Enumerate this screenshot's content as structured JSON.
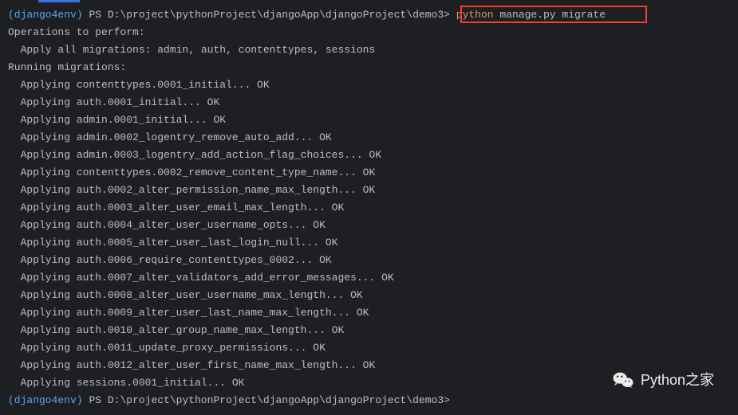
{
  "prompt": {
    "env": "(django4env)",
    "ps": "PS",
    "path": "D:\\project\\pythonProject\\djangoApp\\djangoProject\\demo3",
    "caret": ">",
    "cmd_python": "python",
    "cmd_args": "manage.py migrate"
  },
  "lines": [
    "Operations to perform:",
    "  Apply all migrations: admin, auth, contenttypes, sessions",
    "Running migrations:",
    "  Applying contenttypes.0001_initial... OK",
    "  Applying auth.0001_initial... OK",
    "  Applying admin.0001_initial... OK",
    "  Applying admin.0002_logentry_remove_auto_add... OK",
    "  Applying admin.0003_logentry_add_action_flag_choices... OK",
    "  Applying contenttypes.0002_remove_content_type_name... OK",
    "  Applying auth.0002_alter_permission_name_max_length... OK",
    "  Applying auth.0003_alter_user_email_max_length... OK",
    "  Applying auth.0004_alter_user_username_opts... OK",
    "  Applying auth.0005_alter_user_last_login_null... OK",
    "  Applying auth.0006_require_contenttypes_0002... OK",
    "  Applying auth.0007_alter_validators_add_error_messages... OK",
    "  Applying auth.0008_alter_user_username_max_length... OK",
    "  Applying auth.0009_alter_user_last_name_max_length... OK",
    "  Applying auth.0010_alter_group_name_max_length... OK",
    "  Applying auth.0011_update_proxy_permissions... OK",
    "  Applying auth.0012_alter_user_first_name_max_length... OK",
    "  Applying sessions.0001_initial... OK"
  ],
  "prompt2": {
    "env": "(django4env)",
    "ps": "PS",
    "path": "D:\\project\\pythonProject\\djangoApp\\djangoProject\\demo3",
    "caret": ">"
  },
  "watermark": {
    "text": "Python之家"
  }
}
